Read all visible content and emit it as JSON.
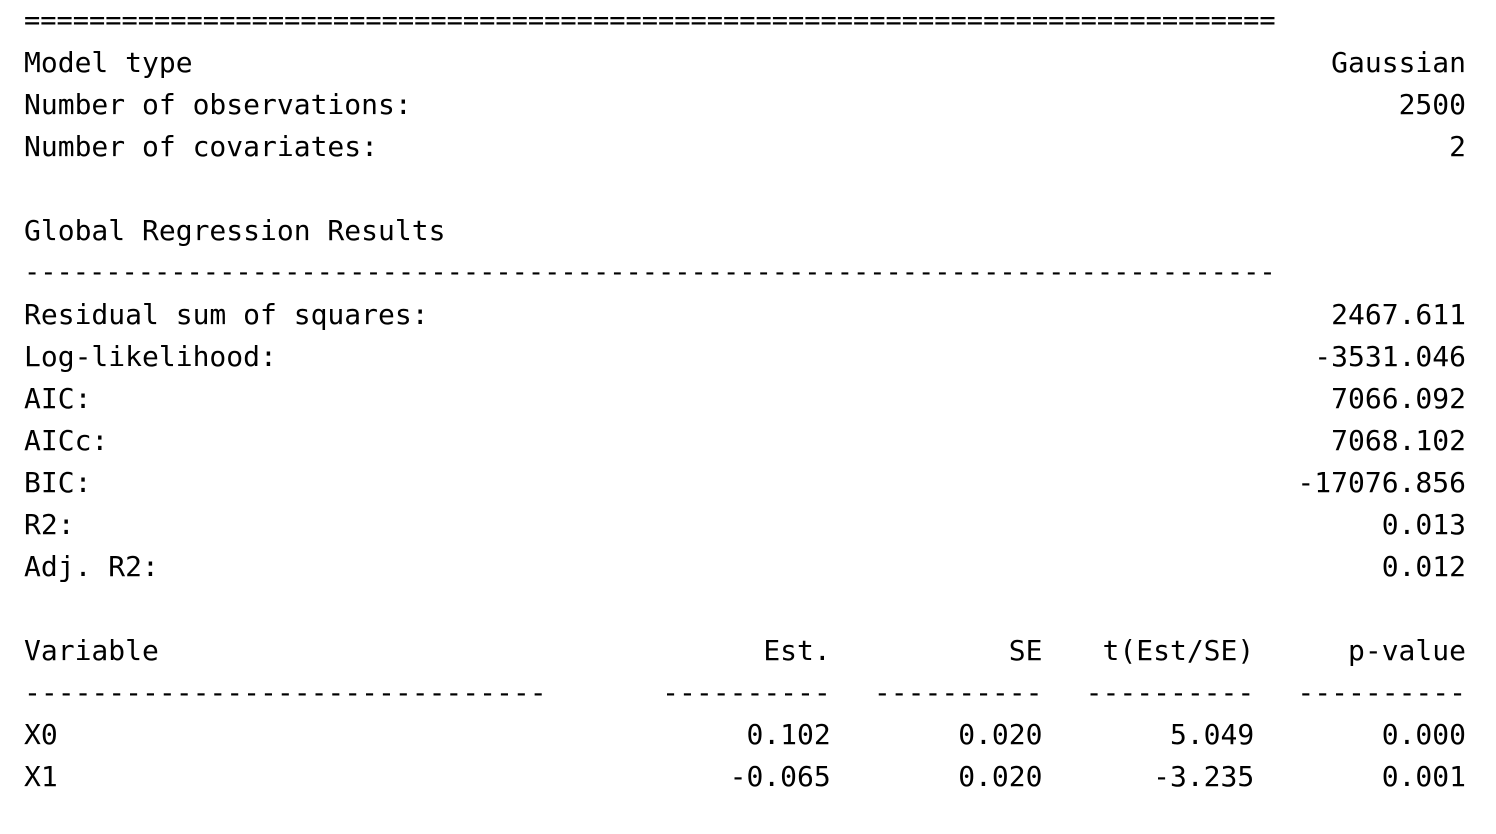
{
  "top_rule": "=============================================================================",
  "model_info": [
    {
      "label": "Model type",
      "value": "Gaussian"
    },
    {
      "label": "Number of observations:",
      "value": "2500"
    },
    {
      "label": "Number of covariates:",
      "value": "2"
    }
  ],
  "global_title": "Global Regression Results",
  "section_rule": "-----------------------------------------------------------------------------",
  "stats": [
    {
      "label": "Residual sum of squares:",
      "value": "2467.611"
    },
    {
      "label": "Log-likelihood:",
      "value": "-3531.046"
    },
    {
      "label": "AIC:",
      "value": "7066.092"
    },
    {
      "label": "AICc:",
      "value": "7068.102"
    },
    {
      "label": "BIC:",
      "value": "-17076.856"
    },
    {
      "label": "R2:",
      "value": "0.013"
    },
    {
      "label": "Adj. R2:",
      "value": "0.012"
    }
  ],
  "table": {
    "headers": [
      "Variable",
      "Est.",
      "SE",
      "t(Est/SE)",
      "p-value"
    ],
    "separators": [
      "-------------------------------",
      "----------",
      "----------",
      "----------",
      "----------"
    ],
    "rows": [
      [
        "X0",
        "0.102",
        "0.020",
        "5.049",
        "0.000"
      ],
      [
        "X1",
        "-0.065",
        "0.020",
        "-3.235",
        "0.001"
      ]
    ]
  }
}
